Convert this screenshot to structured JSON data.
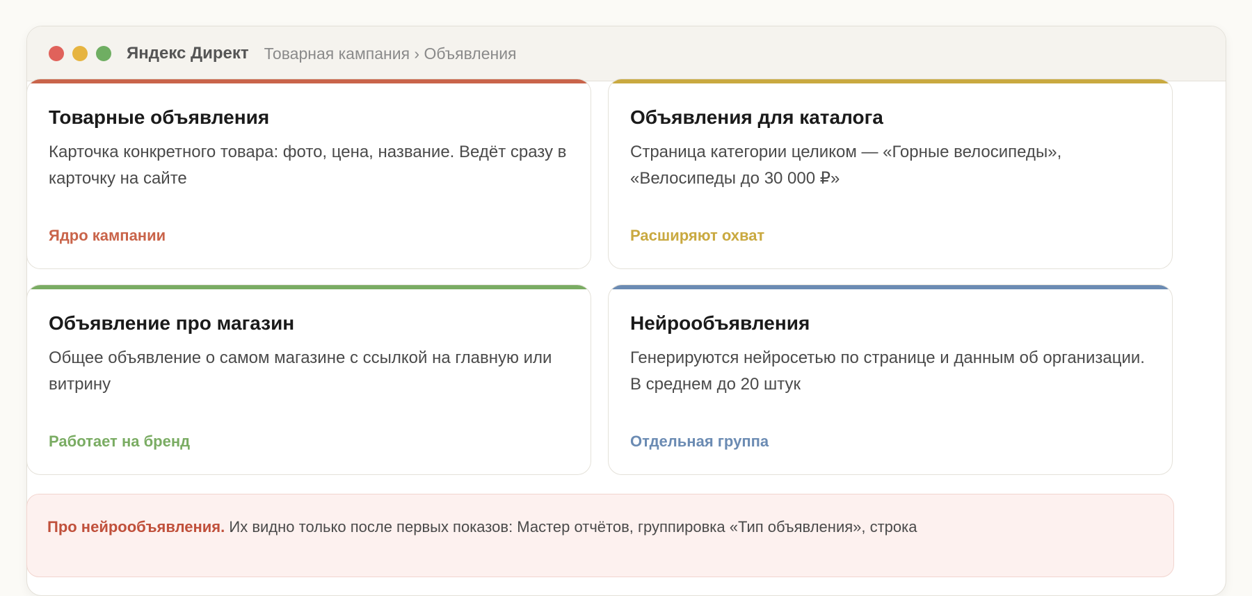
{
  "window": {
    "app_title": "Яндекс Директ",
    "breadcrumb": "Товарная кампания › Объявления"
  },
  "cards": [
    {
      "title": "Товарные объявления",
      "text": "Карточка конкретного товара: фото, цена, название. Ведёт сразу в карточку на сайте",
      "tag": "Ядро кампании",
      "color": "#c9644a"
    },
    {
      "title": "Объявления для каталога",
      "text": "Страница категории целиком — «Горные велосипеды», «Велосипеды до 30 000 ₽»",
      "tag": "Расширяют охват",
      "color": "#c9a940"
    },
    {
      "title": "Объявление про магазин",
      "text": "Общее объявление о самом магазине с ссылкой на главную или витрину",
      "tag": "Работает на бренд",
      "color": "#7aac63"
    },
    {
      "title": "Нейрообъявления",
      "text": "Генерируются нейросетью по странице и данным об организации. В среднем до 20 штук",
      "tag": "Отдельная группа",
      "color": "#6b8bb3"
    }
  ],
  "note": {
    "label": "Про нейрообъявления.",
    "text": "Их видно только после первых показов: Мастер отчётов, группировка «Тип объявления», строка"
  }
}
